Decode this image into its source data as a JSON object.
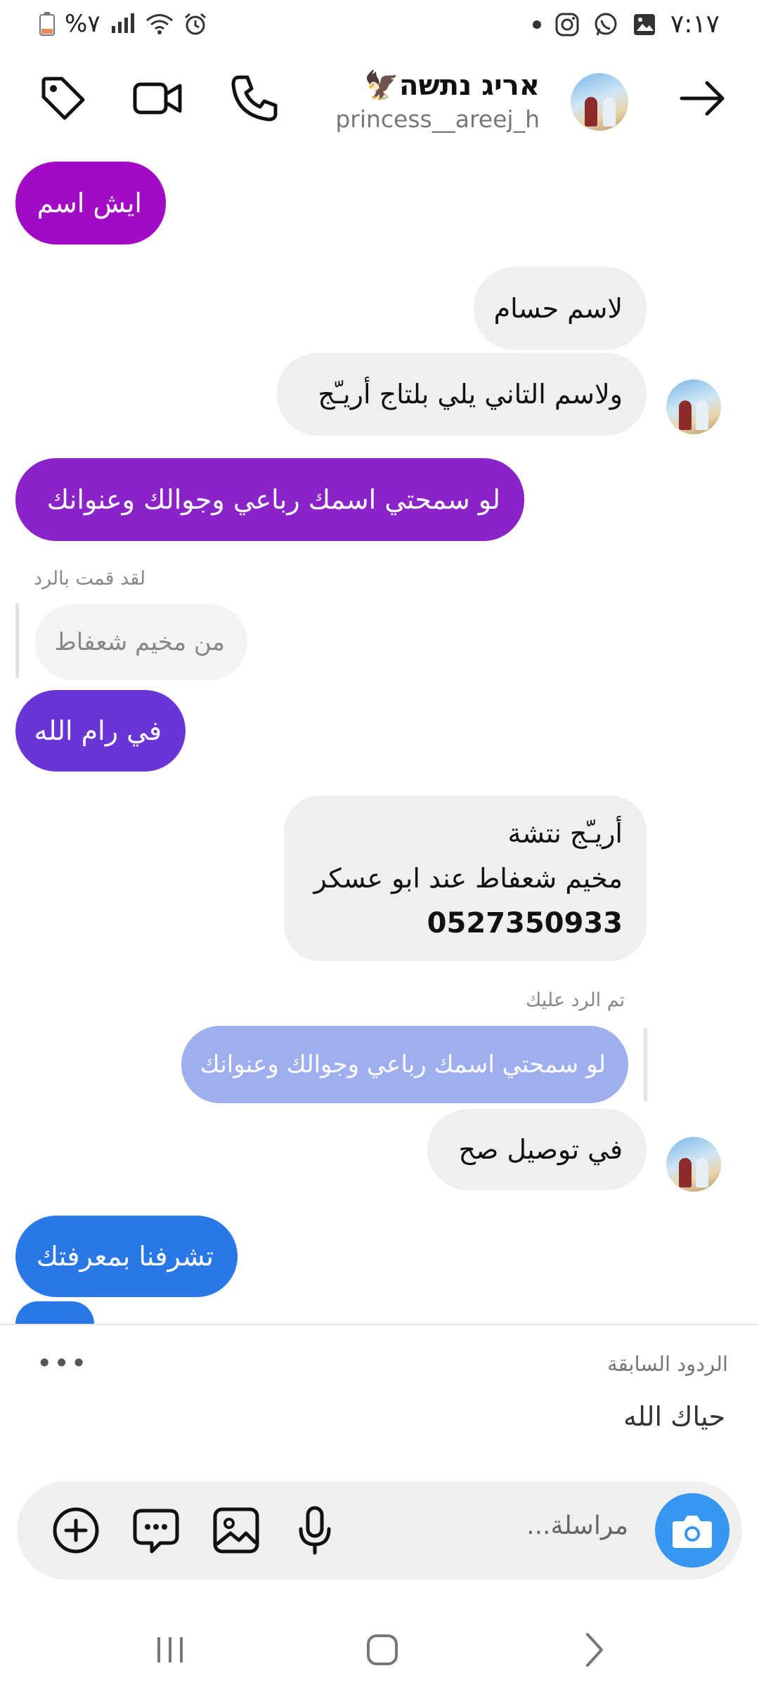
{
  "status_bar": {
    "time": "٧:١٧",
    "battery": "%٧"
  },
  "header": {
    "contact_name": "אריג נתשה🦅",
    "username": "princess__areej_h"
  },
  "messages": [
    {
      "text": "ايش اسم",
      "from": "me",
      "color": "#a10bc4"
    },
    {
      "text": "لاسم حسام",
      "from": "them"
    },
    {
      "text": "ولاسم التاني يلي بلتاج أريـّج",
      "from": "them"
    },
    {
      "text": "لو سمحتي اسمك رباعي وجوالك وعنوانك",
      "from": "me",
      "color": "#8a24c9"
    },
    {
      "reply_label": "لقد قمت بالرد",
      "quoted": "من مخيم شعفاط"
    },
    {
      "text": "في رام الله",
      "from": "me",
      "color": "#6a35d6"
    },
    {
      "lines": [
        "أريـّج نتشة",
        "مخيم شعفاط عند ابو عسكر",
        "0527350933"
      ],
      "from": "them"
    },
    {
      "reply_label": "تم الرد عليك",
      "quoted": "لو سمحتي اسمك رباعي وجوالك وعنوانك"
    },
    {
      "text": "في توصيل صح",
      "from": "them"
    },
    {
      "text": "تشرفنا بمعرفتك",
      "from": "me",
      "color": "#2a78e8"
    }
  ],
  "previous_replies": {
    "label": "الردود السابقة",
    "text": "حياك الله"
  },
  "composer": {
    "placeholder": "مراسلة..."
  },
  "colors": {
    "accent": "#3797f0",
    "bubble_received": "#efefef",
    "quote_sent": "#9eaeef"
  }
}
